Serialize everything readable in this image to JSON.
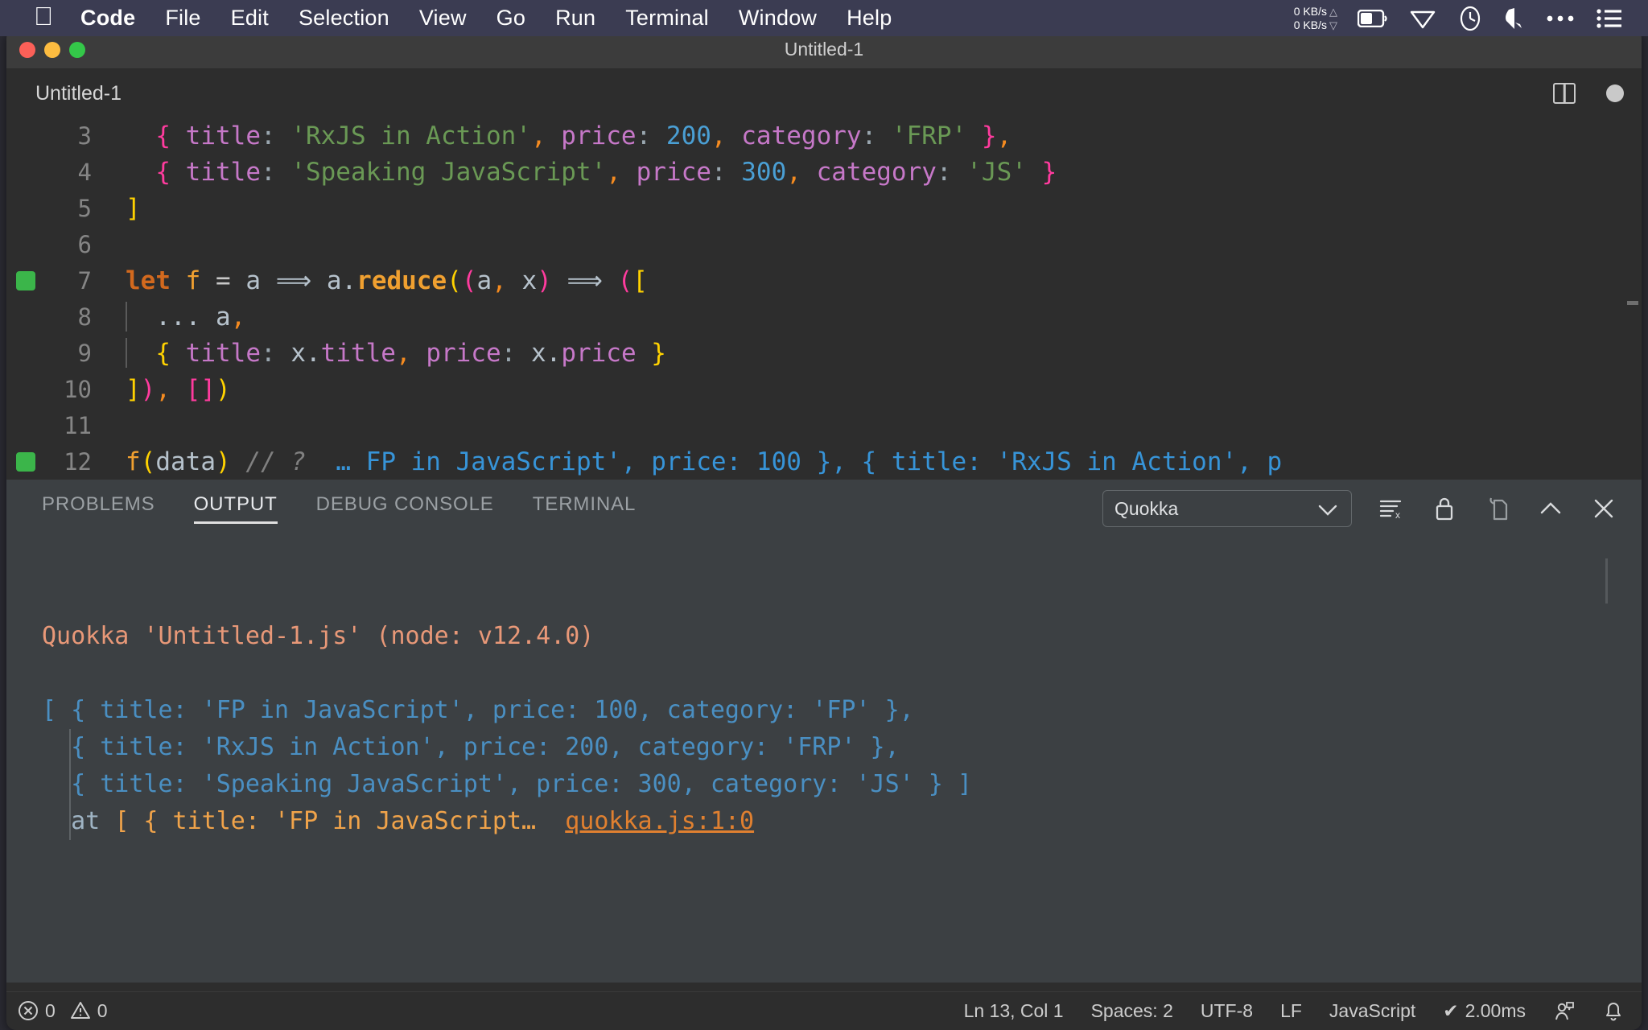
{
  "menubar": {
    "apple_icon": "apple-logo",
    "items": [
      "Code",
      "File",
      "Edit",
      "Selection",
      "View",
      "Go",
      "Run",
      "Terminal",
      "Window",
      "Help"
    ],
    "network_up": "0 KB/s",
    "network_down": "0 KB/s",
    "tray_icons": [
      "battery-icon",
      "wifi-icon",
      "time-machine-icon",
      "dropbox-icon",
      "ellipsis-icon",
      "control-center-icon"
    ]
  },
  "window": {
    "title": "Untitled-1",
    "traffic_lights": [
      "close",
      "minimize",
      "zoom"
    ]
  },
  "editor": {
    "tab_label": "Untitled-1",
    "split_icon": "split-editor-icon",
    "dirty_icon": "unsaved-dot-icon",
    "lines": [
      {
        "number": "3",
        "runnable": false,
        "indent_guide": false,
        "tokens": [
          {
            "t": "  ",
            "c": "t-plain"
          },
          {
            "t": "{",
            "c": "t-brace-pink"
          },
          {
            "t": " title",
            "c": "t-key"
          },
          {
            "t": ":",
            "c": "t-colon"
          },
          {
            "t": " 'RxJS in Action'",
            "c": "t-str"
          },
          {
            "t": ",",
            "c": "t-comma"
          },
          {
            "t": " price",
            "c": "t-key"
          },
          {
            "t": ":",
            "c": "t-colon"
          },
          {
            "t": " 200",
            "c": "t-num"
          },
          {
            "t": ",",
            "c": "t-comma"
          },
          {
            "t": " category",
            "c": "t-key"
          },
          {
            "t": ":",
            "c": "t-colon"
          },
          {
            "t": " 'FRP'",
            "c": "t-str"
          },
          {
            "t": " }",
            "c": "t-brace-pink"
          },
          {
            "t": ",",
            "c": "t-comma"
          }
        ]
      },
      {
        "number": "4",
        "runnable": false,
        "indent_guide": false,
        "tokens": [
          {
            "t": "  ",
            "c": "t-plain"
          },
          {
            "t": "{",
            "c": "t-brace-pink"
          },
          {
            "t": " title",
            "c": "t-key"
          },
          {
            "t": ":",
            "c": "t-colon"
          },
          {
            "t": " 'Speaking JavaScript'",
            "c": "t-str"
          },
          {
            "t": ",",
            "c": "t-comma"
          },
          {
            "t": " price",
            "c": "t-key"
          },
          {
            "t": ":",
            "c": "t-colon"
          },
          {
            "t": " 300",
            "c": "t-num"
          },
          {
            "t": ",",
            "c": "t-comma"
          },
          {
            "t": " category",
            "c": "t-key"
          },
          {
            "t": ":",
            "c": "t-colon"
          },
          {
            "t": " 'JS'",
            "c": "t-str"
          },
          {
            "t": " }",
            "c": "t-brace-pink"
          }
        ]
      },
      {
        "number": "5",
        "runnable": false,
        "indent_guide": false,
        "tokens": [
          {
            "t": "]",
            "c": "t-brace-yellow"
          }
        ]
      },
      {
        "number": "6",
        "runnable": false,
        "indent_guide": false,
        "tokens": []
      },
      {
        "number": "7",
        "runnable": true,
        "indent_guide": false,
        "tokens": [
          {
            "t": "let",
            "c": "t-kw"
          },
          {
            "t": " ",
            "c": "t-plain"
          },
          {
            "t": "f",
            "c": "t-var"
          },
          {
            "t": " ",
            "c": "t-plain"
          },
          {
            "t": "=",
            "c": "t-eq"
          },
          {
            "t": " ",
            "c": "t-plain"
          },
          {
            "t": "a",
            "c": "t-plain"
          },
          {
            "t": " ⟹ ",
            "c": "t-plain"
          },
          {
            "t": "a",
            "c": "t-plain"
          },
          {
            "t": ".",
            "c": "t-plain"
          },
          {
            "t": "reduce",
            "c": "t-fn"
          },
          {
            "t": "(",
            "c": "t-brace-yellow"
          },
          {
            "t": "(",
            "c": "t-brace-pink"
          },
          {
            "t": "a",
            "c": "t-plain"
          },
          {
            "t": ",",
            "c": "t-comma"
          },
          {
            "t": " x",
            "c": "t-plain"
          },
          {
            "t": ")",
            "c": "t-brace-pink"
          },
          {
            "t": " ⟹ ",
            "c": "t-plain"
          },
          {
            "t": "(",
            "c": "t-brace-pink"
          },
          {
            "t": "[",
            "c": "t-brace-yellow"
          }
        ]
      },
      {
        "number": "8",
        "runnable": false,
        "indent_guide": true,
        "tokens": [
          {
            "t": "  ...",
            "c": "t-plain"
          },
          {
            "t": " a",
            "c": "t-plain"
          },
          {
            "t": ",",
            "c": "t-comma"
          }
        ]
      },
      {
        "number": "9",
        "runnable": false,
        "indent_guide": true,
        "tokens": [
          {
            "t": "  ",
            "c": "t-plain"
          },
          {
            "t": "{",
            "c": "t-brace-yellow"
          },
          {
            "t": " title",
            "c": "t-key"
          },
          {
            "t": ":",
            "c": "t-colon"
          },
          {
            "t": " x",
            "c": "t-plain"
          },
          {
            "t": ".",
            "c": "t-plain"
          },
          {
            "t": "title",
            "c": "t-key"
          },
          {
            "t": ",",
            "c": "t-comma"
          },
          {
            "t": " price",
            "c": "t-key"
          },
          {
            "t": ":",
            "c": "t-colon"
          },
          {
            "t": " x",
            "c": "t-plain"
          },
          {
            "t": ".",
            "c": "t-plain"
          },
          {
            "t": "price",
            "c": "t-key"
          },
          {
            "t": " }",
            "c": "t-brace-yellow"
          }
        ]
      },
      {
        "number": "10",
        "runnable": false,
        "indent_guide": false,
        "tokens": [
          {
            "t": "]",
            "c": "t-brace-yellow"
          },
          {
            "t": ")",
            "c": "t-brace-pink"
          },
          {
            "t": ",",
            "c": "t-comma"
          },
          {
            "t": " ",
            "c": "t-plain"
          },
          {
            "t": "[",
            "c": "t-brace-pink"
          },
          {
            "t": "]",
            "c": "t-brace-pink"
          },
          {
            "t": ")",
            "c": "t-brace-yellow"
          }
        ]
      },
      {
        "number": "11",
        "runnable": false,
        "indent_guide": false,
        "tokens": []
      },
      {
        "number": "12",
        "runnable": true,
        "indent_guide": false,
        "tokens": [
          {
            "t": "f",
            "c": "t-var"
          },
          {
            "t": "(",
            "c": "t-brace-yellow"
          },
          {
            "t": "data",
            "c": "t-plain"
          },
          {
            "t": ")",
            "c": "t-brace-yellow"
          },
          {
            "t": " // ?  ",
            "c": "t-comment"
          },
          {
            "t": "… FP in JavaScript', price: 100 }, { title: 'RxJS in Action', p",
            "c": "t-result"
          }
        ]
      }
    ]
  },
  "panel": {
    "tabs": [
      {
        "label": "PROBLEMS",
        "active": false
      },
      {
        "label": "OUTPUT",
        "active": true
      },
      {
        "label": "DEBUG CONSOLE",
        "active": false
      },
      {
        "label": "TERMINAL",
        "active": false
      }
    ],
    "channel_select": {
      "value": "Quokka",
      "chevron": "chevron-down-icon"
    },
    "actions": [
      {
        "name": "clear-output-icon"
      },
      {
        "name": "lock-scroll-icon"
      },
      {
        "name": "open-in-editor-icon"
      },
      {
        "name": "collapse-panel-icon"
      },
      {
        "name": "close-panel-icon"
      }
    ],
    "output_lines": [
      {
        "indent_guide": false,
        "segments": [
          {
            "t": "Quokka 'Untitled-1.js' (node: v12.4.0)",
            "c": "c-salmon"
          }
        ]
      },
      {
        "indent_guide": false,
        "segments": []
      },
      {
        "indent_guide": false,
        "segments": [
          {
            "t": "[ { title: 'FP in JavaScript', price: 100, category: 'FP' },",
            "c": "c-blue"
          }
        ]
      },
      {
        "indent_guide": true,
        "segments": [
          {
            "t": "  { title: 'RxJS in Action', price: 200, category: 'FRP' },",
            "c": "c-blue"
          }
        ]
      },
      {
        "indent_guide": true,
        "segments": [
          {
            "t": "  { title: 'Speaking JavaScript', price: 300, category: 'JS' } ]",
            "c": "c-blue"
          }
        ]
      },
      {
        "indent_guide": true,
        "segments": [
          {
            "t": "  at ",
            "c": "c-steel"
          },
          {
            "t": "[ { title: 'FP in JavaScript…  ",
            "c": "c-orange"
          },
          {
            "t": "quokka.js:1:0",
            "c": "c-link"
          }
        ]
      }
    ]
  },
  "statusbar": {
    "errors_icon": "error-circle-icon",
    "errors_count": "0",
    "warnings_icon": "warning-triangle-icon",
    "warnings_count": "0",
    "cursor_position": "Ln 13, Col 1",
    "indentation": "Spaces: 2",
    "encoding": "UTF-8",
    "eol": "LF",
    "language": "JavaScript",
    "quokka_time": "2.00ms",
    "quokka_check": "✔",
    "feedback_icon": "feedback-person-icon",
    "bell_icon": "notifications-bell-icon"
  }
}
